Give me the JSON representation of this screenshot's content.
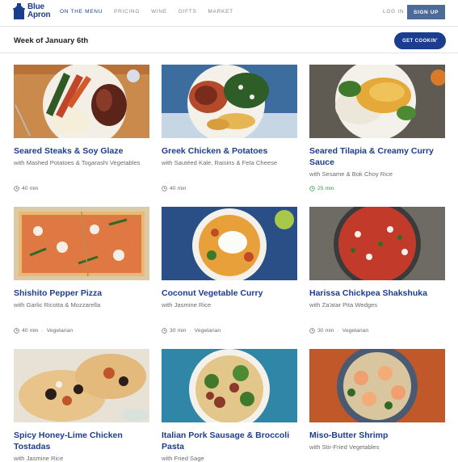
{
  "brand": {
    "line1": "Blue",
    "line2": "Apron"
  },
  "nav": {
    "links": [
      "ON THE MENU",
      "PRICING",
      "WINE",
      "GIFTS",
      "MARKET"
    ],
    "login": "LOG IN",
    "signup": "SIGN UP"
  },
  "week": {
    "title": "Week of January 6th",
    "cta": "GET COOKIN'"
  },
  "recipes": [
    {
      "title": "Seared Steaks & Soy Glaze",
      "subtitle": "with Mashed Potatoes & Togarashi Vegetables",
      "time": "40 min",
      "tag": ""
    },
    {
      "title": "Greek Chicken & Potatoes",
      "subtitle": "with Sautéed Kale, Raisins & Feta Cheese",
      "time": "40 min",
      "tag": ""
    },
    {
      "title": "Seared Tilapia & Creamy Curry Sauce",
      "subtitle": "with Sesame & Bok Choy Rice",
      "time": "25 min",
      "tag": ""
    },
    {
      "title": "Shishito Pepper Pizza",
      "subtitle": "with Garlic Ricotta & Mozzarella",
      "time": "40 min",
      "tag": "Vegetarian"
    },
    {
      "title": "Coconut Vegetable Curry",
      "subtitle": "with Jasmine Rice",
      "time": "30 min",
      "tag": "Vegetarian"
    },
    {
      "title": "Harissa Chickpea Shakshuka",
      "subtitle": "with Za'atar Pita Wedges",
      "time": "30 min",
      "tag": "Vegetarian"
    },
    {
      "title": "Spicy Honey-Lime Chicken Tostadas",
      "subtitle": "with Jasmine Rice",
      "time": "",
      "tag": ""
    },
    {
      "title": "Italian Pork Sausage & Broccoli Pasta",
      "subtitle": "with Fried Sage",
      "time": "",
      "tag": ""
    },
    {
      "title": "Miso-Butter Shrimp",
      "subtitle": "with Stir-Fried Vegetables",
      "time": "",
      "tag": ""
    }
  ],
  "colors": {
    "brand_blue": "#1b3d8f",
    "signup_bg": "#4e6a99",
    "quick_time_green": "#3a9b47"
  },
  "icons": {
    "time": "clock-icon",
    "logo": "apron-logo-icon"
  }
}
